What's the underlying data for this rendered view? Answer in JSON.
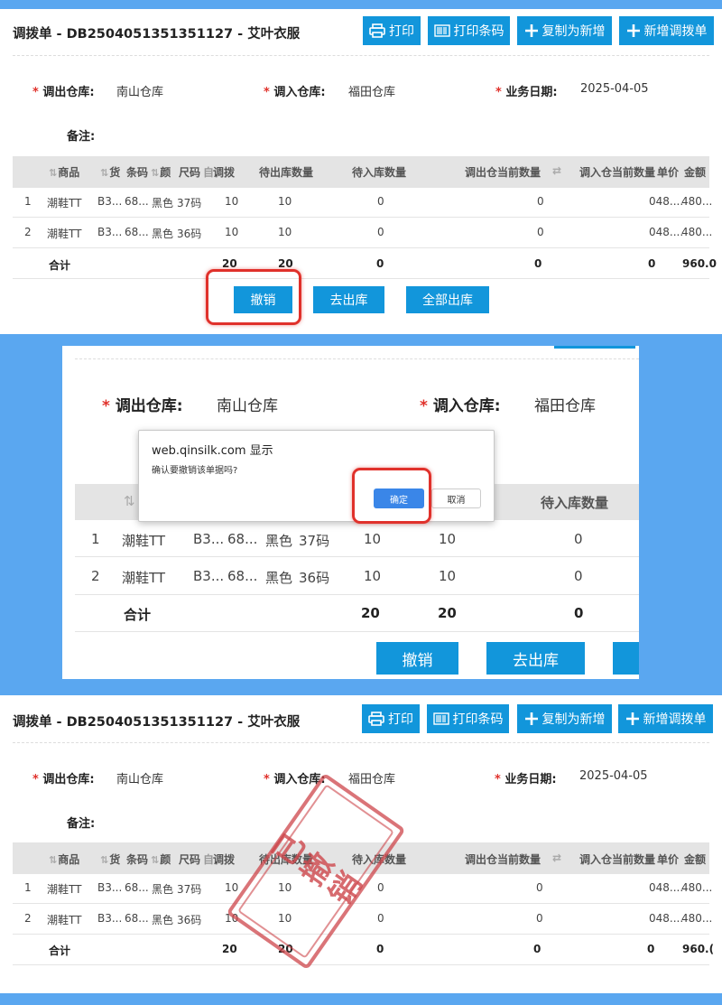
{
  "header": {
    "title": "调拨单 - DB2504051351351127 - 艾叶衣服",
    "print_label": "打印",
    "print_barcode_label": "打印条码",
    "copy_new_label": "复制为新增",
    "add_transfer_label": "新增调拨单"
  },
  "form": {
    "from_warehouse_label": "调出仓库:",
    "from_warehouse_value": "南山仓库",
    "to_warehouse_label": "调入仓库:",
    "to_warehouse_value": "福田仓库",
    "date_label": "业务日期:",
    "date_value": "2025-04-05",
    "remark_label": "备注:",
    "required_mark": "*"
  },
  "table": {
    "columns": [
      "商品",
      "货",
      "条码",
      "颜",
      "尺码",
      "调拨",
      "待出库数量",
      "待入库数量",
      "调出仓当前数量",
      "调入仓当前数量",
      "单价",
      "金额"
    ],
    "sort_icon": "⇅",
    "swap_icon": "⇄",
    "trunc_col": "自",
    "rows": [
      {
        "idx": "1",
        "product": "潮鞋TT",
        "sku": "B3...",
        "barcode": "68...",
        "color": "黑色",
        "size": "37码",
        "transfer": "10",
        "pending_out": "10",
        "pending_in": "0",
        "out_qty": "0",
        "price": "048....",
        "amount": "480..."
      },
      {
        "idx": "2",
        "product": "潮鞋TT",
        "sku": "B3...",
        "barcode": "68...",
        "color": "黑色",
        "size": "36码",
        "transfer": "10",
        "pending_out": "10",
        "pending_in": "0",
        "out_qty": "0",
        "price": "048....",
        "amount": "480..."
      }
    ],
    "total": {
      "label": "合计",
      "transfer": "20",
      "pending_out": "20",
      "pending_in": "0",
      "out_qty": "0",
      "in_qty": "0",
      "amount": "960.0",
      "amount_cut": "960.("
    }
  },
  "actions": {
    "cancel_label": "撤销",
    "outbound_label": "去出库",
    "all_outbound_label": "全部出库"
  },
  "dialog": {
    "origin": "web.qinsilk.com 显示",
    "message": "确认要撤销该单据吗?",
    "ok_label": "确定",
    "cancel_label": "取消"
  },
  "stamp": {
    "text": "已撤销"
  },
  "colors": {
    "accent": "#1296db",
    "highlight": "#e0312b",
    "background": "#5aa7f0",
    "table_header": "#e4e4e4"
  }
}
